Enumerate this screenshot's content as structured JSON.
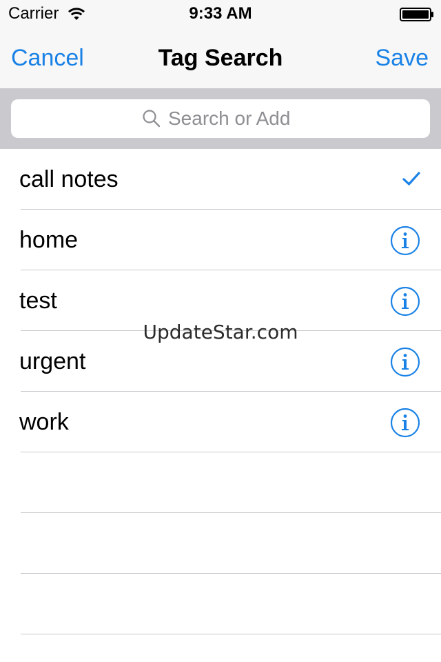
{
  "status_bar": {
    "carrier": "Carrier",
    "time": "9:33 AM",
    "wifi_icon": "wifi-icon",
    "battery_icon": "battery-icon"
  },
  "nav": {
    "cancel_label": "Cancel",
    "title": "Tag Search",
    "save_label": "Save",
    "accent_color": "#1a82e6"
  },
  "search": {
    "placeholder": "Search or Add",
    "value": "",
    "icon": "search-icon"
  },
  "tags": [
    {
      "label": "call notes",
      "accessory": "checkmark",
      "selected": true
    },
    {
      "label": "home",
      "accessory": "info",
      "selected": false
    },
    {
      "label": "test",
      "accessory": "info",
      "selected": false
    },
    {
      "label": "urgent",
      "accessory": "info",
      "selected": false
    },
    {
      "label": "work",
      "accessory": "info",
      "selected": false
    }
  ],
  "watermark": "UpdateStar.com",
  "colors": {
    "accent": "#1a82e6",
    "separator": "#c8c7cc",
    "search_bar_bg": "#c9c9ce",
    "nav_bg": "#f7f7f7"
  }
}
